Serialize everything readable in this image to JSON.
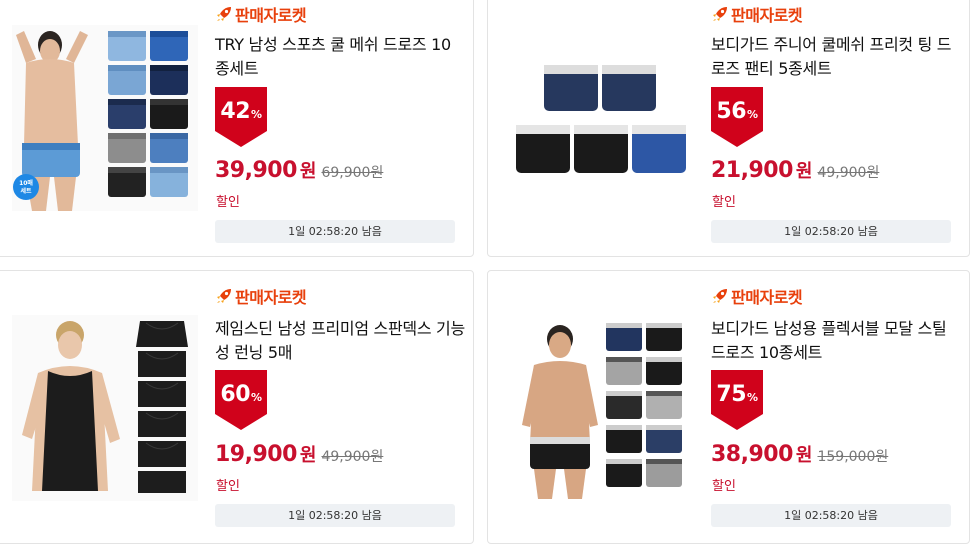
{
  "products": [
    {
      "badge": "판매자로켓",
      "title": "TRY 남성 스포츠 쿨 메쉬 드로즈 10종세트",
      "discount_value": "42",
      "discount_pct": "%",
      "price": "39,900",
      "currency": "원",
      "original_price": "69,900원",
      "sale_label": "할인",
      "timer": "1일 02:58:20 남음",
      "image_tag": "10매\n세트"
    },
    {
      "badge": "판매자로켓",
      "title": "보디가드 주니어 쿨메쉬 프리컷 팅 드로즈 팬티 5종세트",
      "discount_value": "56",
      "discount_pct": "%",
      "price": "21,900",
      "currency": "원",
      "original_price": "49,900원",
      "sale_label": "할인",
      "timer": "1일 02:58:20 남음"
    },
    {
      "badge": "판매자로켓",
      "title": "제임스딘 남성 프리미엄 스판덱스 기능성 런닝 5매",
      "discount_value": "60",
      "discount_pct": "%",
      "price": "19,900",
      "currency": "원",
      "original_price": "49,900원",
      "sale_label": "할인",
      "timer": "1일 02:58:20 남음"
    },
    {
      "badge": "판매자로켓",
      "title": "보디가드 남성용 플렉서블 모달 스틸 드로즈 10종세트",
      "discount_value": "75",
      "discount_pct": "%",
      "price": "38,900",
      "currency": "원",
      "original_price": "159,000원",
      "sale_label": "할인",
      "timer": "1일 02:58:20 남음"
    }
  ],
  "colors": {
    "badge": "#e8400c",
    "discount_bg": "#d0021b",
    "price": "#c8102e",
    "timer_bg": "#eef1f4"
  }
}
